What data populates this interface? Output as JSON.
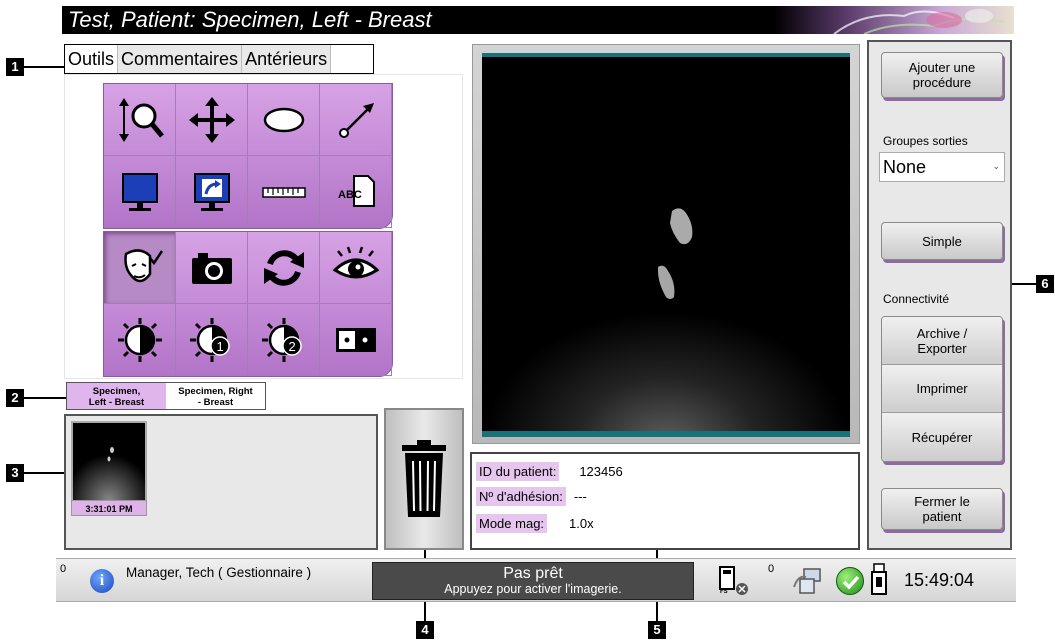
{
  "title": "Test, Patient:  Specimen, Left - Breast",
  "callouts": [
    "1",
    "2",
    "3",
    "4",
    "5",
    "6"
  ],
  "tabs": [
    "Outils",
    "Commentaires",
    "Antérieurs"
  ],
  "tools_row1": [
    "zoom-icon",
    "pan-icon",
    "ellipse-icon",
    "arrow-icon",
    "monitor-icon",
    "send-monitor-icon",
    "ruler-icon",
    "abc-note-icon"
  ],
  "tools_row2": [
    "face-check-icon",
    "camera-icon",
    "refresh-icon",
    "eye-icon",
    "contrast-icon",
    "contrast-1-icon",
    "contrast-2-icon",
    "window-level-icon"
  ],
  "tool_text": {
    "abc": "ABC",
    "one": "1",
    "two": "2"
  },
  "specimen_tabs": [
    "Specimen,\nLeft - Breast",
    "Specimen, Right\n- Breast"
  ],
  "thumbnail": {
    "time": "3:31:01 PM"
  },
  "patient_info": {
    "id_label": "ID du patient:",
    "id_value": "123456",
    "accession_label": "Nº d'adhésion:",
    "accession_value": "---",
    "mag_label": "Mode mag:",
    "mag_value": "1.0x"
  },
  "right_panel": {
    "add_procedure": "Ajouter une\nprocédure",
    "groups_label": "Groupes sorties",
    "groups_value": "None",
    "simple": "Simple",
    "connectivity_label": "Connectivité",
    "archive": "Archive /\nExporter",
    "print": "Imprimer",
    "retrieve": "Récupérer",
    "close_patient": "Fermer le\npatient"
  },
  "status": {
    "left_count": "0",
    "user": "Manager, Tech ( Gestionnaire )",
    "not_ready": "Pas prêt",
    "not_ready_sub": "Appuyez pour activer l'imagerie.",
    "right_count": "0",
    "clock": "15:49:04"
  },
  "colors": {
    "accent_purple": "#c58fd8",
    "viewer_teal": "#17727a",
    "label_purple": "#e6c6ef"
  }
}
